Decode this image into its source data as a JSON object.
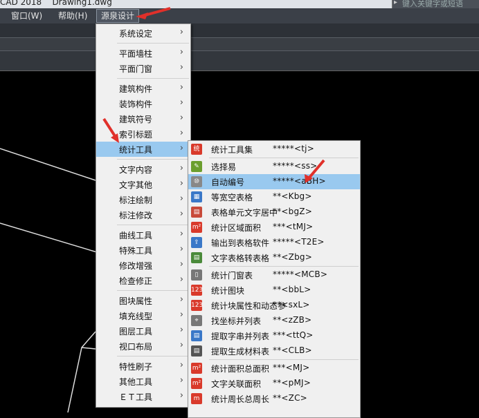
{
  "title": "CAD 2018    Drawing1.dwg",
  "search": {
    "placeholder": "键入关键字或短语"
  },
  "menubar": [
    {
      "label": "窗口(W)"
    },
    {
      "label": "帮助(H)"
    },
    {
      "label": "源泉设计",
      "active": true
    }
  ],
  "main_menu": [
    {
      "label": "系统设定"
    },
    {
      "label": "平面墙柱",
      "sep_before": true
    },
    {
      "label": "平面门窗"
    },
    {
      "label": "建筑构件",
      "sep_before": true
    },
    {
      "label": "装饰构件"
    },
    {
      "label": "建筑符号"
    },
    {
      "label": "索引标题"
    },
    {
      "label": "统计工具",
      "highlighted": true
    },
    {
      "label": "文字内容",
      "sep_before": true
    },
    {
      "label": "文字其他"
    },
    {
      "label": "标注绘制"
    },
    {
      "label": "标注修改"
    },
    {
      "label": "曲线工具",
      "sep_before": true
    },
    {
      "label": "特殊工具"
    },
    {
      "label": "修改增强"
    },
    {
      "label": "检查修正"
    },
    {
      "label": "图块属性",
      "sep_before": true
    },
    {
      "label": "填充线型"
    },
    {
      "label": "图层工具"
    },
    {
      "label": "视口布局"
    },
    {
      "label": "特性刷子",
      "sep_before": true
    },
    {
      "label": "其他工具"
    },
    {
      "label": "ＥＴ工具"
    }
  ],
  "submenu": [
    {
      "label": "统计工具集",
      "shortcut": "*****<tj>",
      "icon": "stats-toolset-icon",
      "icon_text": "统",
      "icon_color": "#d93a2b"
    },
    {
      "label": "选择易",
      "shortcut": "*****<ss>",
      "icon": "select-easy-icon",
      "icon_text": "✎",
      "icon_color": "#6b9e2e",
      "sep_before": true
    },
    {
      "label": "自动编号",
      "shortcut": "*****<aBH>",
      "icon": "auto-number-icon",
      "icon_text": "⑩",
      "icon_color": "#888888",
      "highlighted": true
    },
    {
      "label": "等宽空表格",
      "shortcut": "**<Kbg>",
      "icon": "table-icon",
      "icon_text": "▦",
      "icon_color": "#3a78c8"
    },
    {
      "label": "表格单元文字居中",
      "shortcut": "**<bgZ>",
      "icon": "table-center-icon",
      "icon_text": "▤",
      "icon_color": "#c84a3a"
    },
    {
      "label": "统计区域面积",
      "shortcut": "***<tMJ>",
      "icon": "area-stats-icon",
      "icon_text": "m²",
      "icon_color": "#d93a2b"
    },
    {
      "label": "输出到表格软件",
      "shortcut": "*****<T2E>",
      "icon": "export-excel-icon",
      "icon_text": "⇪",
      "icon_color": "#3a78c8"
    },
    {
      "label": "文字表格转表格",
      "shortcut": "**<Zbg>",
      "icon": "text-table-icon",
      "icon_text": "▤",
      "icon_color": "#4a8a3a"
    },
    {
      "label": "统计门窗表",
      "shortcut": "*****<MCB>",
      "icon": "door-window-icon",
      "icon_text": "▯",
      "icon_color": "#777777",
      "sep_before": true
    },
    {
      "label": "统计图块",
      "shortcut": "**<bbL>",
      "icon": "block-count-icon",
      "icon_text": "123",
      "icon_color": "#d93a2b"
    },
    {
      "label": "统计块属性和动态参",
      "shortcut": "**<sxL>",
      "icon": "block-attr-icon",
      "icon_text": "123",
      "icon_color": "#d93a2b"
    },
    {
      "label": "找坐标并列表",
      "shortcut": "**<zZB>",
      "icon": "coordinate-list-icon",
      "icon_text": "⌖",
      "icon_color": "#777777"
    },
    {
      "label": "提取字串并列表",
      "shortcut": "***<ttQ>",
      "icon": "extract-text-icon",
      "icon_text": "▤",
      "icon_color": "#3a78c8"
    },
    {
      "label": "提取生成材料表",
      "shortcut": "**<CLB>",
      "icon": "material-table-icon",
      "icon_text": "▤",
      "icon_color": "#555555"
    },
    {
      "label": "统计面积总面积",
      "shortcut": "***<MJ>",
      "icon": "total-area-icon",
      "icon_text": "m²",
      "icon_color": "#d93a2b",
      "sep_before": true
    },
    {
      "label": "文字关联面积",
      "shortcut": "**<pMJ>",
      "icon": "text-area-link-icon",
      "icon_text": "m²",
      "icon_color": "#d93a2b"
    },
    {
      "label": "统计周长总周长",
      "shortcut": "**<ZC>",
      "icon": "perimeter-icon",
      "icon_text": "m",
      "icon_color": "#d93a2b"
    }
  ]
}
